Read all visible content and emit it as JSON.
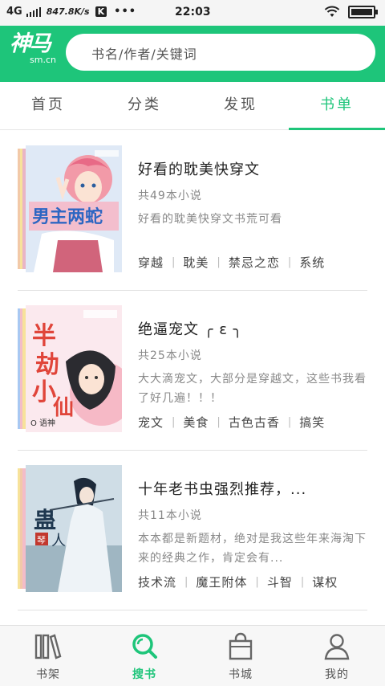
{
  "status_bar": {
    "network": "4G",
    "speed": "847.8K/s",
    "app_badge": "K",
    "dots": "•••",
    "time": "22:03"
  },
  "header": {
    "logo_main": "神马",
    "logo_sub": "sm.cn",
    "search_placeholder": "书名/作者/关键词"
  },
  "tabs": [
    {
      "label": "首页",
      "active": false
    },
    {
      "label": "分类",
      "active": false
    },
    {
      "label": "发现",
      "active": false
    },
    {
      "label": "书单",
      "active": true
    }
  ],
  "booklists": [
    {
      "title": "好看的耽美快穿文",
      "count": "共49本小说",
      "desc": "好看的耽美快穿文书荒可看",
      "tags": [
        "穿越",
        "耽美",
        "禁忌之恋",
        "系统"
      ]
    },
    {
      "title": "绝逼宠文 ╭ ε ╮",
      "count": "共25本小说",
      "desc": "大大滴宠文，大部分是穿越文，这些书我看了好几遍！！！",
      "tags": [
        "宠文",
        "美食",
        "古色古香",
        "搞笑"
      ]
    },
    {
      "title": "十年老书虫强烈推荐，...",
      "count": "共11本小说",
      "desc": "本本都是新题材，绝对是我这些年来海淘下来的经典之作，肯定会有...",
      "tags": [
        "技术流",
        "魔王附体",
        "斗智",
        "谋权"
      ]
    }
  ],
  "bottom_nav": [
    {
      "label": "书架",
      "icon": "bookshelf-icon",
      "active": false
    },
    {
      "label": "搜书",
      "icon": "search-icon",
      "active": true
    },
    {
      "label": "书城",
      "icon": "shopping-bag-icon",
      "active": false
    },
    {
      "label": "我的",
      "icon": "user-icon",
      "active": false
    }
  ],
  "colors": {
    "brand": "#1ec57a",
    "text": "#333333",
    "muted": "#888888"
  }
}
